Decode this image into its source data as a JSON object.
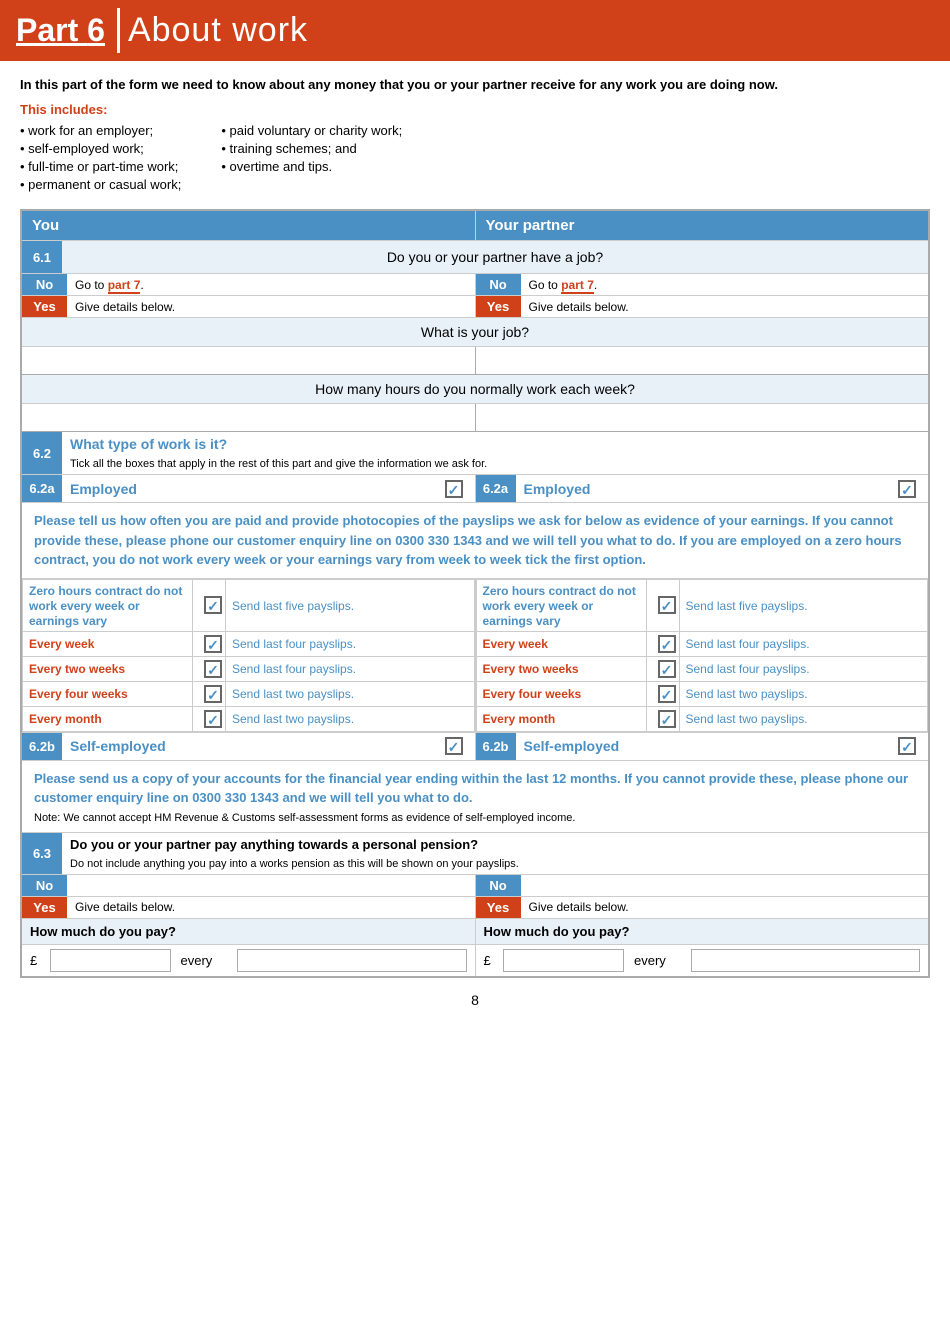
{
  "header": {
    "part_label": "Part ",
    "part_number": "6",
    "title": "About work"
  },
  "intro": {
    "bold_text": "In this part of the form we need to know about any money that you or your partner receive for any work you are doing now.",
    "includes_label": "This includes:",
    "list_left": [
      "work for an employer;",
      "self-employed work;",
      "full-time or part-time work;",
      "permanent or casual work;"
    ],
    "list_right": [
      "paid voluntary or charity work;",
      "training schemes;  and",
      "overtime and tips."
    ]
  },
  "columns": {
    "you": "You",
    "your_partner": "Your partner"
  },
  "section_61": {
    "number": "6.1",
    "question": "Do you or your partner have a job?",
    "you_no": "No",
    "you_no_instruction": "Go to ",
    "you_no_part": "part 7",
    "you_yes": "Yes",
    "you_yes_instruction": "Give details below.",
    "partner_no": "No",
    "partner_no_instruction": "Go to ",
    "partner_no_part": "part 7",
    "partner_yes": "Yes",
    "partner_yes_instruction": "Give details below."
  },
  "what_is_job": "What is your job?",
  "how_many_hours": "How many hours do you normally work each week?",
  "section_62": {
    "number": "6.2",
    "title": "What type of work is it?",
    "subtitle": "Tick all the boxes that apply in the rest of this part and give the information we ask for.",
    "section_62a_number": "6.2a",
    "employed_label": "Employed",
    "tick": "✓"
  },
  "info_text": "Please tell us how often you are paid and provide photocopies of the payslips we ask for below as evidence of your earnings. If you cannot provide these, please phone our customer enquiry line on 0300 330 1343 and we will tell you what to do. If you are employed on a zero hours contract, you do not work every week or your earnings vary from week to week tick the first option.",
  "payment_options": {
    "zero_hours": {
      "label": "Zero hours contract do not work every week or earnings vary",
      "tick": "✓",
      "send": "Send last five payslips."
    },
    "every_week": {
      "label": "Every week",
      "tick": "✓",
      "send": "Send last four payslips."
    },
    "every_two_weeks": {
      "label": "Every two weeks",
      "tick": "✓",
      "send": "Send last four payslips."
    },
    "every_four_weeks": {
      "label": "Every four weeks",
      "tick": "✓",
      "send": "Send last two payslips."
    },
    "every_month": {
      "label": "Every month",
      "tick": "✓",
      "send": "Send last two payslips."
    }
  },
  "section_62b": {
    "number": "6.2b",
    "label": "Self-employed",
    "tick": "✓"
  },
  "self_emp_info": {
    "bold": "Please send us a copy of your accounts for the financial year ending within the last 12 months.  If you cannot provide these, please phone our customer enquiry line on 0300 330 1343 and we will tell you what to do.",
    "note": "Note: We cannot accept HM Revenue & Customs self-assessment forms as evidence of self-employed income."
  },
  "section_63": {
    "number": "6.3",
    "title": "Do you or your partner pay anything towards a personal pension?",
    "subtitle": "Do not include anything you pay into a works pension as this will be shown on your payslips.",
    "you_no": "No",
    "you_yes": "Yes",
    "you_yes_instruction": "Give details below.",
    "partner_no": "No",
    "partner_yes": "Yes",
    "partner_yes_instruction": "Give details below.",
    "how_much_you": "How much do you pay?",
    "how_much_partner": "How much do you pay?",
    "you_pound": "£",
    "you_every": "every",
    "partner_pound": "£",
    "partner_every": "every"
  },
  "page_number": "8"
}
